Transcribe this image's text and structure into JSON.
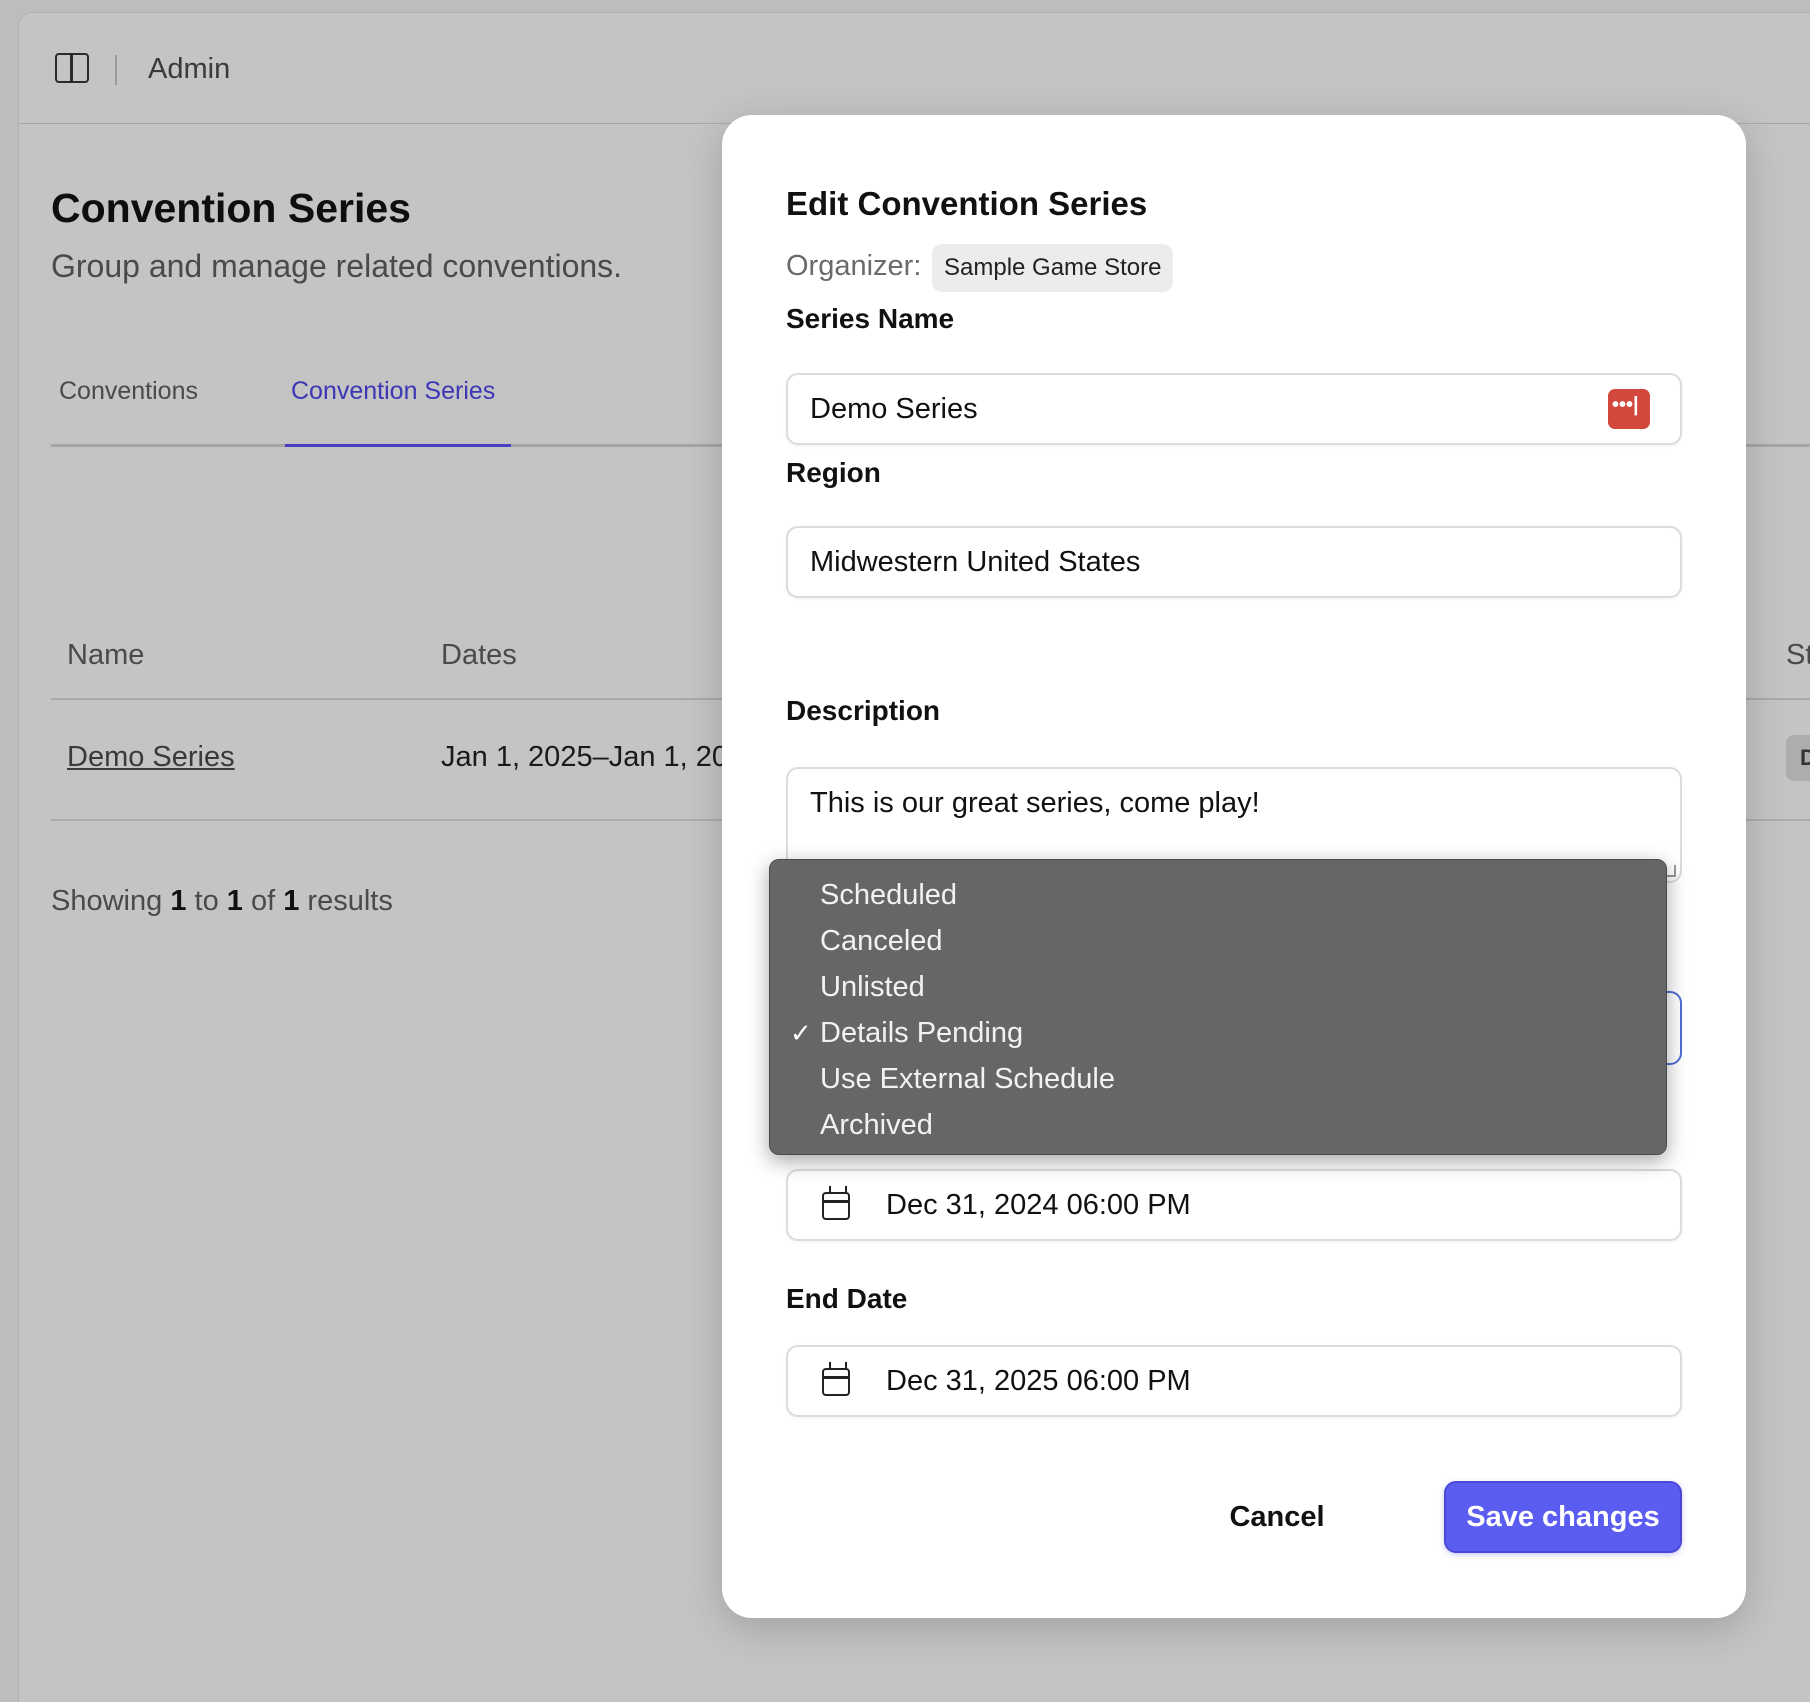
{
  "topbar": {
    "title": "Admin"
  },
  "page": {
    "title": "Convention Series",
    "subtitle": "Group and manage related conventions."
  },
  "tabs": [
    {
      "label": "Conventions",
      "active": false
    },
    {
      "label": "Convention Series",
      "active": true
    }
  ],
  "table": {
    "headers": {
      "name": "Name",
      "dates": "Dates",
      "status": "Sta"
    },
    "rows": [
      {
        "name": "Demo Series",
        "dates": "Jan 1, 2025–Jan 1, 20",
        "status": "DE"
      }
    ]
  },
  "results": {
    "prefix": "Showing",
    "from": "1",
    "to_word": "to",
    "to": "1",
    "of_word": "of",
    "total": "1",
    "suffix": "results"
  },
  "modal": {
    "title": "Edit Convention Series",
    "organizer_label": "Organizer:",
    "organizer_value": "Sample Game Store",
    "series_name_label": "Series Name",
    "series_name_value": "Demo Series",
    "region_label": "Region",
    "region_value": "Midwestern United States",
    "description_label": "Description",
    "description_value": "This is our great series, come play!",
    "start_date_value": "Dec 31, 2024 06:00 PM",
    "end_date_label": "End Date",
    "end_date_value": "Dec 31, 2025 06:00 PM",
    "cancel_label": "Cancel",
    "save_label": "Save changes"
  },
  "status_dropdown": {
    "check_glyph": "✓",
    "options": [
      {
        "label": "Scheduled",
        "selected": false
      },
      {
        "label": "Canceled",
        "selected": false
      },
      {
        "label": "Unlisted",
        "selected": false
      },
      {
        "label": "Details Pending",
        "selected": true
      },
      {
        "label": "Use External Schedule",
        "selected": false
      },
      {
        "label": "Archived",
        "selected": false
      }
    ]
  },
  "colors": {
    "accent": "#5b5cf0",
    "tab_active": "#3b37b5",
    "password_manager": "#d2483c",
    "dropdown_bg": "#666666"
  }
}
